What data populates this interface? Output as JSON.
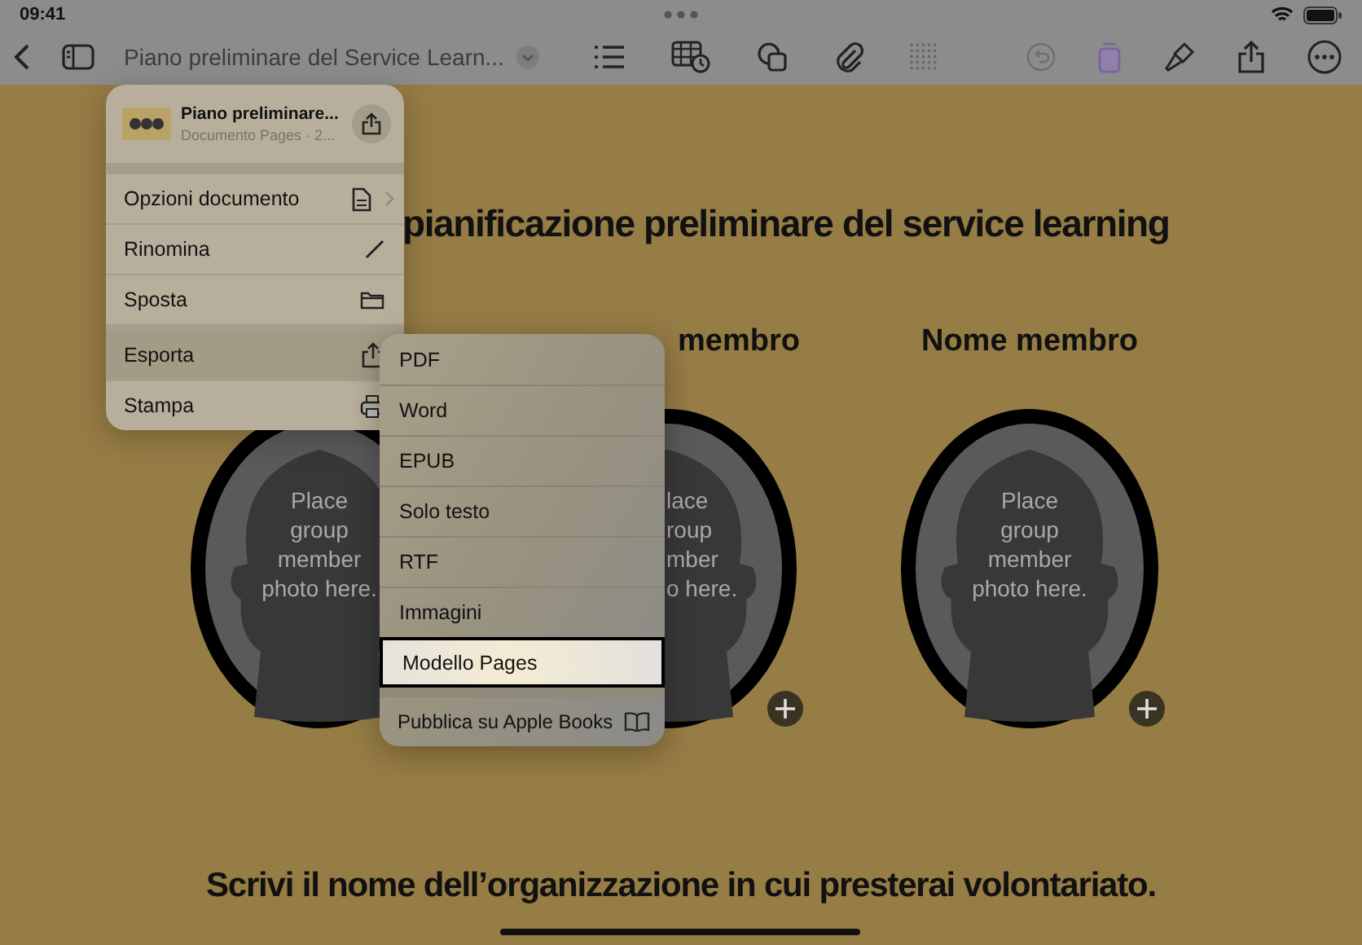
{
  "status_bar": {
    "time": "09:41"
  },
  "toolbar": {
    "document_title": "Piano preliminare del Service Learn..."
  },
  "document": {
    "title": "pianificazione preliminare del service learning",
    "members": [
      {
        "caption": [
          "Place",
          "group",
          "member",
          "photo here."
        ],
        "covered": false,
        "add_button": false
      },
      {
        "heading": "membro",
        "caption": [
          "lace",
          "roup",
          "mber",
          "o here."
        ],
        "covered": true,
        "add_button": true
      },
      {
        "heading": "Nome membro",
        "caption": [
          "Place",
          "group",
          "member",
          "photo here."
        ],
        "covered": false,
        "add_button": true
      }
    ],
    "footer": "Scrivi il nome dell’organizzazione in cui presterai volontariato."
  },
  "menu": {
    "header": {
      "name": "Piano preliminare...",
      "subtitle": "Documento Pages · 2..."
    },
    "items": [
      {
        "label": "Opzioni documento",
        "kind": "document",
        "submenu": true,
        "selected": false
      },
      {
        "label": "Rinomina",
        "kind": "pencil",
        "submenu": false,
        "selected": false
      },
      {
        "label": "Sposta",
        "kind": "folder",
        "submenu": false,
        "selected": false
      },
      {
        "label": "Esporta",
        "kind": "share",
        "submenu": false,
        "selected": true
      },
      {
        "label": "Stampa",
        "kind": "printer",
        "submenu": false,
        "selected": false
      }
    ]
  },
  "export_menu": {
    "items": [
      {
        "label": "PDF",
        "kind": "format",
        "selected": false
      },
      {
        "label": "Word",
        "kind": "format",
        "selected": false
      },
      {
        "label": "EPUB",
        "kind": "format",
        "selected": false
      },
      {
        "label": "Solo testo",
        "kind": "format",
        "selected": false
      },
      {
        "label": "RTF",
        "kind": "format",
        "selected": false
      },
      {
        "label": "Immagini",
        "kind": "format",
        "selected": false
      },
      {
        "label": "Modello Pages",
        "kind": "format",
        "selected": true
      },
      {
        "label": "Pubblica su Apple Books",
        "kind": "publish",
        "selected": false
      }
    ]
  }
}
